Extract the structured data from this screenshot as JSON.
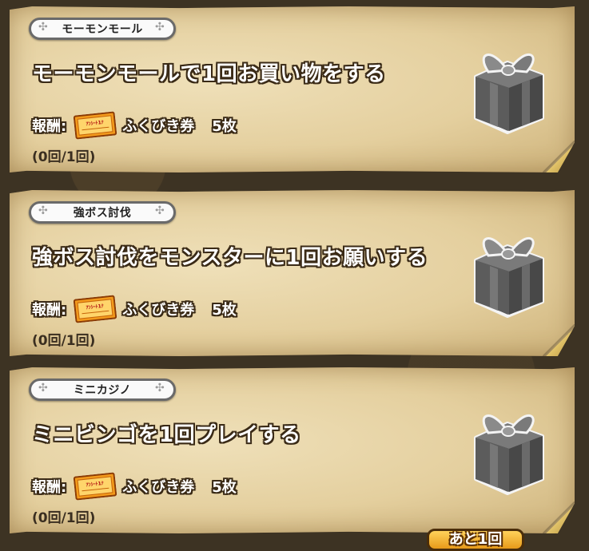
{
  "reward_label": "報酬:",
  "ticket_text": "ｱﾝｼｰﾄ1ﾅ",
  "missions": [
    {
      "category": "モーモンモール",
      "title": "モーモンモールで1回お買い物をする",
      "reward_item": "ふくびき券",
      "reward_count": "5枚",
      "progress": "(0回/1回)"
    },
    {
      "category": "強ボス討伐",
      "title": "強ボス討伐をモンスターに1回お願いする",
      "reward_item": "ふくびき券",
      "reward_count": "5枚",
      "progress": "(0回/1回)"
    },
    {
      "category": "ミニカジノ",
      "title": "ミニビンゴを1回プレイする",
      "reward_item": "ふくびき券",
      "reward_count": "5枚",
      "progress": "(0回/1回)"
    }
  ],
  "bottom_button": "あと1回",
  "icons": {
    "gift": "gift-box-icon",
    "ticket": "lottery-ticket-icon",
    "ornament": "flower-ornament-icon"
  },
  "colors": {
    "parchment": "#e4cf9e",
    "outline": "#3a2a16",
    "gift": "#6b6b6b"
  }
}
